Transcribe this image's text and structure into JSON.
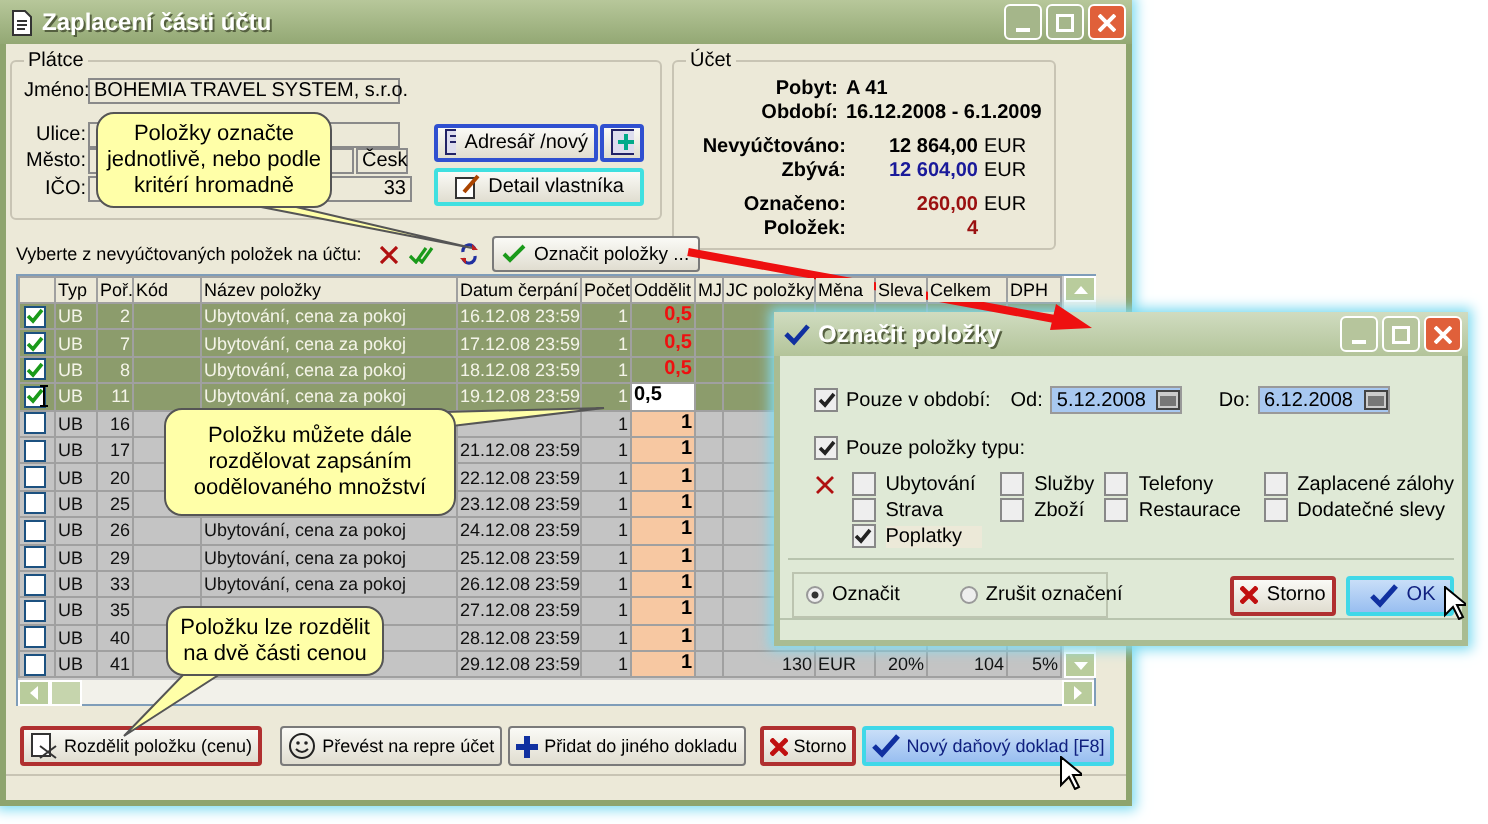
{
  "main_window": {
    "title": "Zaplacení části účtu",
    "payer": {
      "legend": "Plátce",
      "name_label": "Jméno:",
      "name_value": "BOHEMIA TRAVEL SYSTEM, s.r.o.",
      "street_label": "Ulice:",
      "city_label": "Město:",
      "city_country": "Česk",
      "id_label": "IČO:",
      "id_value": "33"
    },
    "address_book_button": "Adresář /nový",
    "owner_detail_button": "Detail vlastníka",
    "account": {
      "legend": "Účet",
      "stay_label": "Pobyt:",
      "stay": "A 41",
      "period_label": "Období:",
      "period": "16.12.2008 - 6.1.2009",
      "amount_groups": [
        [
          {
            "label": "Nevyúčtováno:",
            "value": "12 864,00",
            "currency": "EUR",
            "color": "#000000"
          },
          {
            "label": "Zbývá:",
            "value": "12 604,00",
            "currency": "EUR",
            "color": "#1a1a9a"
          }
        ],
        [
          {
            "label": "Označeno:",
            "value": "260,00",
            "currency": "EUR",
            "color": "#9a1010"
          },
          {
            "label": "Položek:",
            "value": "4",
            "color": "#9a1010"
          }
        ]
      ]
    },
    "select_label": "Vyberte z nevyúčtovaných položek na účtu:",
    "mark_button": "Označit položky ...",
    "table": {
      "columns": [
        "Typ",
        "Poř.",
        "Kód",
        "Název položky",
        "Datum čerpání",
        "Počet",
        "Oddělit",
        "MJ",
        "JC položky",
        "Měna",
        "Sleva",
        "Celkem",
        "DPH"
      ],
      "rows": [
        {
          "checked": true,
          "editing": false,
          "type": "UB",
          "no": "2",
          "name": "Ubytování, cena za pokoj",
          "date": "16.12.08 23:59",
          "count": "1",
          "split": "0,5"
        },
        {
          "checked": true,
          "editing": false,
          "type": "UB",
          "no": "7",
          "name": "Ubytování, cena za pokoj",
          "date": "17.12.08 23:59",
          "count": "1",
          "split": "0,5"
        },
        {
          "checked": true,
          "editing": false,
          "type": "UB",
          "no": "8",
          "name": "Ubytování, cena za pokoj",
          "date": "18.12.08 23:59",
          "count": "1",
          "split": "0,5"
        },
        {
          "checked": true,
          "editing": true,
          "type": "UB",
          "no": "11",
          "name": "Ubytování, cena za pokoj",
          "date": "19.12.08 23:59",
          "count": "1",
          "split": "0,5"
        },
        {
          "checked": false,
          "editing": false,
          "type": "UB",
          "no": "16",
          "count": "1",
          "split": "1"
        },
        {
          "checked": false,
          "editing": false,
          "type": "UB",
          "no": "17",
          "date": "21.12.08 23:59",
          "count": "1",
          "split": "1"
        },
        {
          "checked": false,
          "editing": false,
          "type": "UB",
          "no": "20",
          "date": "22.12.08 23:59",
          "count": "1",
          "split": "1"
        },
        {
          "checked": false,
          "editing": false,
          "type": "UB",
          "no": "25",
          "date": "23.12.08 23:59",
          "count": "1",
          "split": "1"
        },
        {
          "checked": false,
          "editing": false,
          "type": "UB",
          "no": "26",
          "name": "Ubytování, cena za pokoj",
          "date": "24.12.08 23:59",
          "count": "1",
          "split": "1"
        },
        {
          "checked": false,
          "editing": false,
          "type": "UB",
          "no": "29",
          "name": "Ubytování, cena za pokoj",
          "date": "25.12.08 23:59",
          "count": "1",
          "split": "1"
        },
        {
          "checked": false,
          "editing": false,
          "type": "UB",
          "no": "33",
          "name": "Ubytování, cena za pokoj",
          "date": "26.12.08 23:59",
          "count": "1",
          "split": "1"
        },
        {
          "checked": false,
          "editing": false,
          "type": "UB",
          "no": "35",
          "date": "27.12.08 23:59",
          "count": "1",
          "split": "1"
        },
        {
          "checked": false,
          "editing": false,
          "type": "UB",
          "no": "40",
          "date": "28.12.08 23:59",
          "count": "1",
          "split": "1"
        },
        {
          "checked": false,
          "editing": false,
          "type": "UB",
          "no": "41",
          "date": "29.12.08 23:59",
          "count": "1",
          "split": "1",
          "jc": "130",
          "currency": "EUR",
          "discount": "20%",
          "total": "104",
          "vat": "5%"
        }
      ]
    },
    "buttons": [
      {
        "label": "Rozdělit položku (cenu)",
        "kind": "split"
      },
      {
        "label": "Převést na repre účet",
        "kind": "smiley"
      },
      {
        "label": "Přidat do jiného dokladu",
        "kind": "plus"
      },
      {
        "label": "Storno",
        "kind": "cancel"
      },
      {
        "label": "Nový daňový doklad [F8]",
        "kind": "ok"
      }
    ]
  },
  "callouts": [
    {
      "text": "Položky označte jednotlivě, nebo podle kritérí hromadně"
    },
    {
      "text": "Položku můžete dále rozdělovat zapsáním oodělovaného množství"
    },
    {
      "text": "Položku lze rozdělit na dvě části cenou"
    }
  ],
  "dialog": {
    "title": "Označit položky",
    "period": {
      "label": "Pouze v období:",
      "checked": true,
      "from_label": "Od:",
      "from": "5.12.2008",
      "to_label": "Do:",
      "to": "6.12.2008"
    },
    "types": {
      "label": "Pouze položky typu:",
      "checked": true,
      "columns": [
        [
          {
            "label": "Ubytování",
            "checked": false
          },
          {
            "label": "Strava",
            "checked": false
          },
          {
            "label": "Poplatky",
            "checked": true
          }
        ],
        [
          {
            "label": "Služby",
            "checked": false
          },
          {
            "label": "Zboží",
            "checked": false
          }
        ],
        [
          {
            "label": "Telefony",
            "checked": false
          },
          {
            "label": "Restaurace",
            "checked": false
          }
        ],
        [
          {
            "label": "Zaplacené zálohy",
            "checked": false
          },
          {
            "label": "Dodatečné slevy",
            "checked": false
          }
        ]
      ]
    },
    "modes": [
      {
        "label": "Označit",
        "selected": true
      },
      {
        "label": "Zrušit označení",
        "selected": false
      }
    ],
    "buttons": [
      {
        "label": "Storno",
        "kind": "cancel"
      },
      {
        "label": "OK",
        "kind": "ok"
      }
    ]
  }
}
